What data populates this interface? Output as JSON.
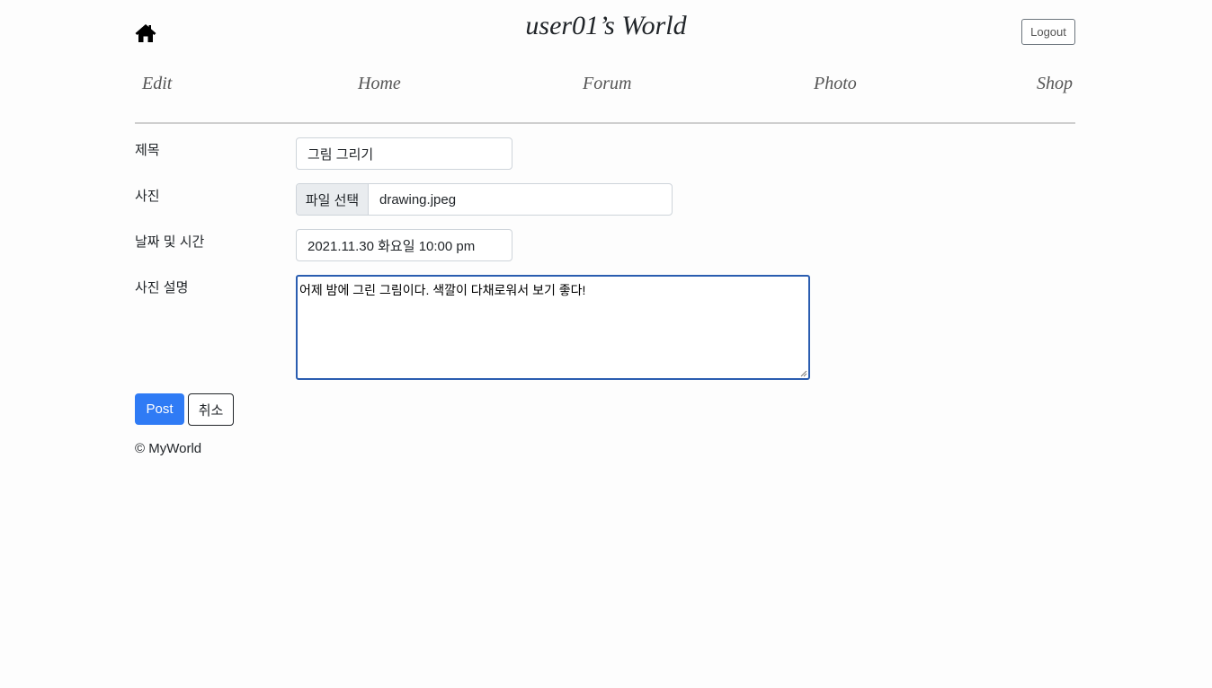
{
  "header": {
    "home_icon": "home-icon",
    "site_title": "user01’s World",
    "logout_label": "Logout"
  },
  "nav": {
    "items": [
      {
        "label": "Edit"
      },
      {
        "label": "Home"
      },
      {
        "label": "Forum"
      },
      {
        "label": "Photo"
      },
      {
        "label": "Shop"
      }
    ]
  },
  "form": {
    "title_label": "제목",
    "title_value": "그림 그리기",
    "photo_label": "사진",
    "file_button_label": "파일 선택",
    "file_name": "drawing.jpeg",
    "datetime_label": "날짜 및 시간",
    "datetime_value": "2021.11.30 화요일 10:00 pm",
    "description_label": "사진 설명",
    "description_value": "어제 밤에 그린 그림이다. 색깔이 다채로워서 보기 좋다!",
    "post_label": "Post",
    "cancel_label": "취소"
  },
  "footer": {
    "copyright": "© MyWorld"
  },
  "colors": {
    "primary": "#2f7bf5",
    "focus_border": "#2a5db0"
  }
}
